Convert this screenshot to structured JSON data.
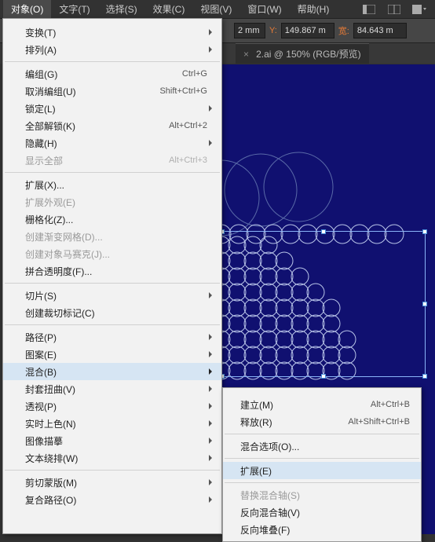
{
  "menubar": {
    "items": [
      "对象(O)",
      "文字(T)",
      "选择(S)",
      "效果(C)",
      "视图(V)",
      "窗口(W)",
      "帮助(H)"
    ],
    "activeIndex": 0
  },
  "toolbar": {
    "x_suffix": "2 mm",
    "y_label": "Y:",
    "y_value": "149.867 m",
    "w_label": "宽:",
    "w_value": "84.643 m"
  },
  "tab": {
    "label": "2.ai @ 150% (RGB/预览)"
  },
  "menu": {
    "groups": [
      [
        {
          "label": "变换(T)",
          "sub": true
        },
        {
          "label": "排列(A)",
          "sub": true
        }
      ],
      [
        {
          "label": "编组(G)",
          "shortcut": "Ctrl+G"
        },
        {
          "label": "取消编组(U)",
          "shortcut": "Shift+Ctrl+G"
        },
        {
          "label": "锁定(L)",
          "sub": true
        },
        {
          "label": "全部解锁(K)",
          "shortcut": "Alt+Ctrl+2"
        },
        {
          "label": "隐藏(H)",
          "sub": true
        },
        {
          "label": "显示全部",
          "shortcut": "Alt+Ctrl+3",
          "disabled": true
        }
      ],
      [
        {
          "label": "扩展(X)..."
        },
        {
          "label": "扩展外观(E)",
          "disabled": true
        },
        {
          "label": "栅格化(Z)..."
        },
        {
          "label": "创建渐变网格(D)...",
          "disabled": true
        },
        {
          "label": "创建对象马赛克(J)...",
          "disabled": true
        },
        {
          "label": "拼合透明度(F)..."
        }
      ],
      [
        {
          "label": "切片(S)",
          "sub": true
        },
        {
          "label": "创建裁切标记(C)"
        }
      ],
      [
        {
          "label": "路径(P)",
          "sub": true
        },
        {
          "label": "图案(E)",
          "sub": true
        },
        {
          "label": "混合(B)",
          "sub": true,
          "highlight": true
        },
        {
          "label": "封套扭曲(V)",
          "sub": true
        },
        {
          "label": "透视(P)",
          "sub": true
        },
        {
          "label": "实时上色(N)",
          "sub": true
        },
        {
          "label": "图像描摹",
          "sub": true
        },
        {
          "label": "文本绕排(W)",
          "sub": true
        }
      ],
      [
        {
          "label": "剪切蒙版(M)",
          "sub": true
        },
        {
          "label": "复合路径(O)",
          "sub": true
        }
      ]
    ]
  },
  "submenu": {
    "groups": [
      [
        {
          "label": "建立(M)",
          "shortcut": "Alt+Ctrl+B"
        },
        {
          "label": "释放(R)",
          "shortcut": "Alt+Shift+Ctrl+B"
        }
      ],
      [
        {
          "label": "混合选项(O)..."
        }
      ],
      [
        {
          "label": "扩展(E)",
          "highlight": true
        }
      ],
      [
        {
          "label": "替换混合轴(S)",
          "disabled": true
        },
        {
          "label": "反向混合轴(V)"
        },
        {
          "label": "反向堆叠(F)"
        }
      ]
    ]
  }
}
